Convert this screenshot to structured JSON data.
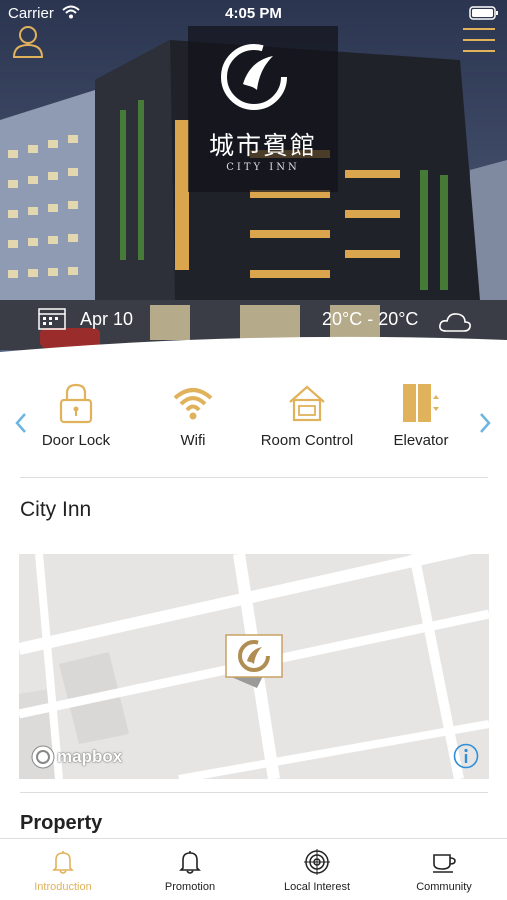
{
  "status_bar": {
    "carrier": "Carrier",
    "time": "4:05 PM"
  },
  "hero": {
    "logo_chinese": "城市賓館",
    "logo_english": "CITY INN",
    "date": "Apr 10",
    "temperature": "20°C - 20°C"
  },
  "features": [
    {
      "label": "Door Lock",
      "icon": "lock-icon"
    },
    {
      "label": "Wifi",
      "icon": "wifi-icon"
    },
    {
      "label": "Room Control",
      "icon": "home-icon"
    },
    {
      "label": "Elevator",
      "icon": "elevator-icon"
    }
  ],
  "hotel_name": "City Inn",
  "map": {
    "attribution": "mapbox"
  },
  "property_title": "Property",
  "tabs": [
    {
      "label": "Introduction",
      "icon": "bell-icon",
      "active": true
    },
    {
      "label": "Promotion",
      "icon": "bell-icon",
      "active": false
    },
    {
      "label": "Local Interest",
      "icon": "target-icon",
      "active": false
    },
    {
      "label": "Community",
      "icon": "coffee-cup-icon",
      "active": false
    }
  ],
  "colors": {
    "accent": "#e0b25c",
    "info": "#2f8fd8"
  }
}
